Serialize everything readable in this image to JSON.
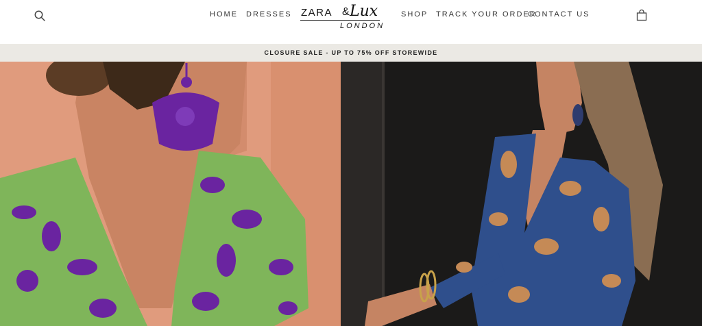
{
  "header": {
    "nav_left": [
      "HOME",
      "DRESSES"
    ],
    "nav_right": [
      "SHOP",
      "TRACK YOUR ORDER",
      "CONTACT US"
    ],
    "logo": {
      "line1": "ZARA",
      "amp": "&",
      "script": "Lux",
      "line2": "LONDON"
    },
    "icons": {
      "search": "search-icon",
      "cart": "shopping-bag-icon"
    }
  },
  "announcement": {
    "text": "CLOSURE SALE - UP TO 75% OFF STOREWIDE"
  },
  "colors": {
    "announcement_bg": "#ebe9e4",
    "left_wall": "#e09b7d",
    "dress_green": "#7fb55a",
    "print_purple": "#6a24a0",
    "right_bg": "#1b1a19",
    "dress_blue": "#2f4f8c",
    "print_orange": "#c58a56"
  }
}
